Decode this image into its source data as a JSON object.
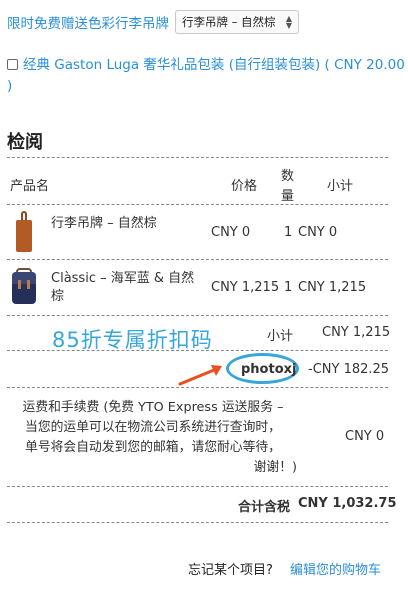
{
  "promo": {
    "link_text": "限时免费赠送色彩行李吊牌",
    "select_value": "行李吊牌 – 自然棕"
  },
  "gift_option": {
    "label": "经典 Gaston Luga 奢华礼品包装 (自行组装包装) ( CNY 20.00 )"
  },
  "review": {
    "title": "检阅",
    "columns": {
      "product": "产品名",
      "price": "价格",
      "qty_line1": "数",
      "qty_line2": "量",
      "subtotal": "小计"
    },
    "items": [
      {
        "name": "行李吊牌 – 自然棕",
        "price": "CNY 0",
        "qty": "1",
        "subtotal": "CNY 0",
        "image_icon": "luggage-tag-icon"
      },
      {
        "name_line1": "Clàssic – 海军蓝 & 自然",
        "name_line2": "棕",
        "price": "CNY 1,215",
        "qty": "1",
        "subtotal": "CNY 1,215",
        "image_icon": "backpack-icon"
      }
    ],
    "subtotal_label": "小计",
    "subtotal_value": "CNY 1,215",
    "coupon_overlay_text": "85折专属折扣码",
    "coupon_code": "photoxj",
    "discount_value": "-CNY 182.25",
    "shipping": {
      "line1": "运费和手续费 (免费 YTO Express 运送服务 –",
      "line2": "当您的运单可以在物流公司系统进行查询时，",
      "line3": "单号将会自动发到您的邮箱，请您耐心等待，",
      "line4": "谢谢！)",
      "value": "CNY 0"
    },
    "total_label": "合计含税",
    "total_value": "CNY 1,032.75"
  },
  "footer": {
    "question": "忘记某个项目?",
    "edit_link": "编辑您的购物车"
  },
  "colors": {
    "link": "#2a8fd6",
    "coupon_overlay": "#37a6d8",
    "arrow": "#e8501e"
  }
}
